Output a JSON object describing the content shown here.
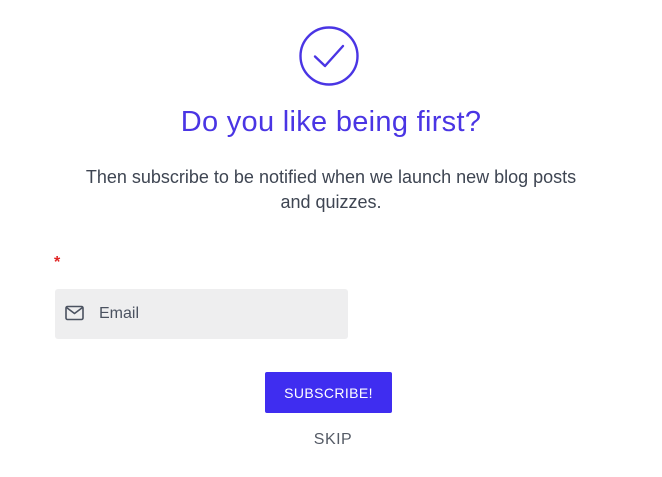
{
  "modal": {
    "icon": "check-circle-icon",
    "title": "Do you like being first?",
    "subtitle": "Then subscribe to be notified when we launch new blog posts and quizzes.",
    "required_marker": "*",
    "email": {
      "icon": "mail-icon",
      "placeholder": "Email",
      "value": ""
    },
    "subscribe_label": "SUBSCRIBE!",
    "skip_label": "SKIP"
  },
  "colors": {
    "accent": "#4a35e4",
    "button": "#3f2df0",
    "input_bg": "#eeeeef",
    "required": "#e02424"
  }
}
